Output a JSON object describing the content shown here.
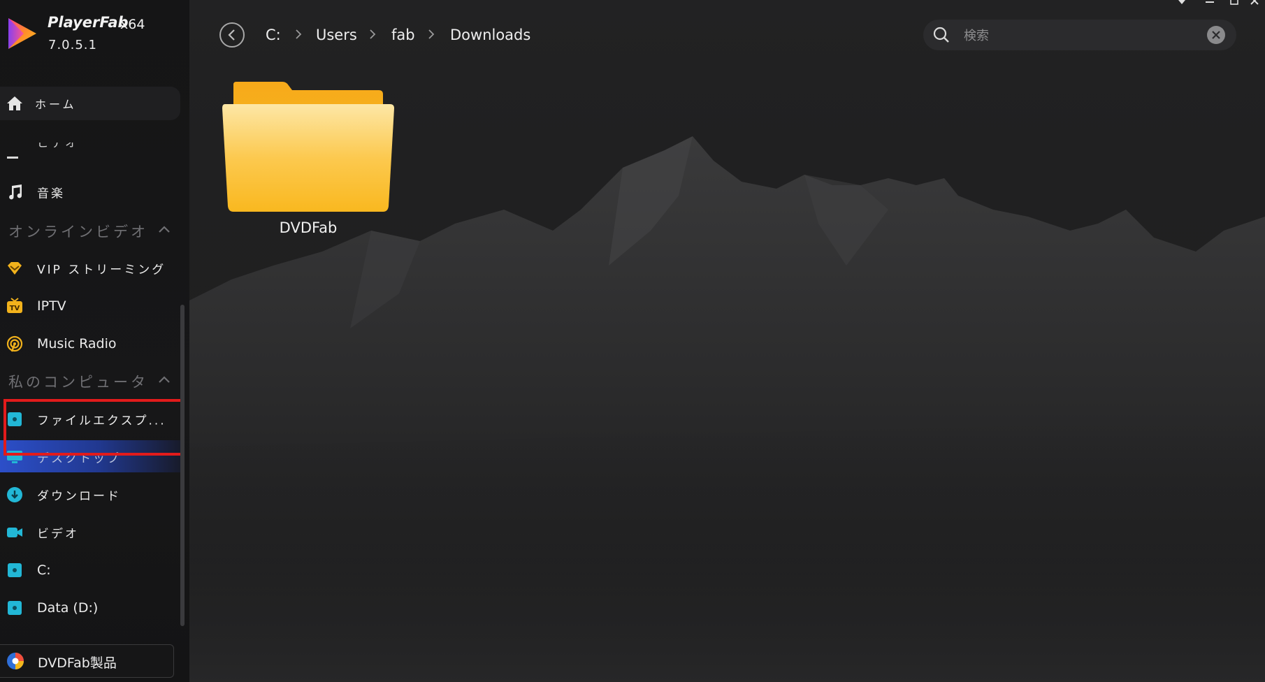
{
  "app": {
    "brand": "PlayerFab",
    "arch": "x64",
    "version": "7.0.5.1"
  },
  "sidebar": {
    "home_label": "ホーム",
    "cut_item_label": "ビデオ",
    "music_label": "音楽",
    "online_section": "オンラインビデオ",
    "online_items": [
      {
        "label": "VIP ストリーミング",
        "icon": "vip-diamond-icon"
      },
      {
        "label": "IPTV",
        "icon": "tv-icon"
      },
      {
        "label": "Music Radio",
        "icon": "radio-icon"
      }
    ],
    "computer_section": "私のコンピュータ",
    "computer_items": [
      {
        "label": "ファイルエクスプ...",
        "icon": "file-explorer-icon"
      },
      {
        "label": "デスクトップ",
        "icon": "desktop-icon"
      },
      {
        "label": "ダウンロード",
        "icon": "download-icon"
      },
      {
        "label": "ビデオ",
        "icon": "video-camera-icon"
      },
      {
        "label": "C:",
        "icon": "drive-icon"
      },
      {
        "label": "Data (D:)",
        "icon": "drive-icon"
      }
    ],
    "bottom_button": "DVDFab製品"
  },
  "breadcrumb": [
    "C:",
    "Users",
    "fab",
    "Downloads"
  ],
  "search": {
    "placeholder": "検索",
    "value": ""
  },
  "files": [
    {
      "name": "DVDFab",
      "type": "folder"
    }
  ],
  "colors": {
    "accent_blue": "#2c4fc9",
    "highlight_red": "#e21b1b",
    "folder_yellow": "#fbb924",
    "icon_cyan": "#22b7d6"
  }
}
